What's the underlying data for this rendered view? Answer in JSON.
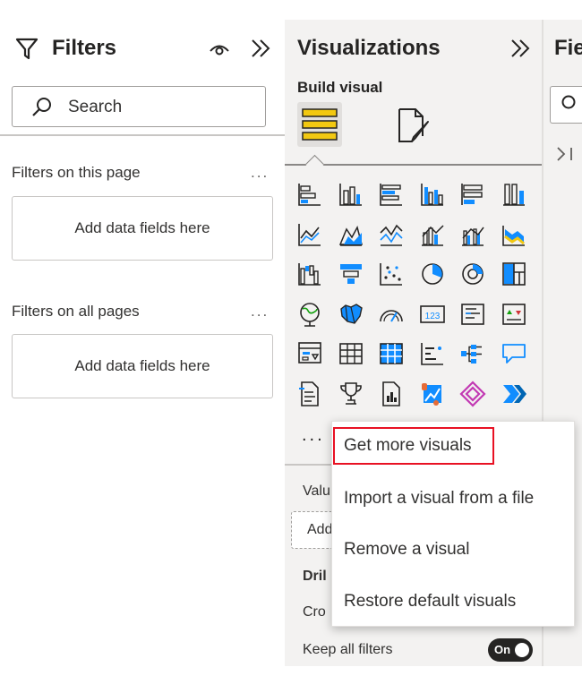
{
  "filters": {
    "title": "Filters",
    "search_placeholder": "Search",
    "this_page_title": "Filters on this page",
    "this_page_drop": "Add data fields here",
    "all_pages_title": "Filters on all pages",
    "all_pages_drop": "Add data fields here",
    "more": "..."
  },
  "visualizations": {
    "title": "Visualizations",
    "build_label": "Build visual",
    "more_visuals": "...",
    "values_label": "Valu",
    "add_label": "Add",
    "drill_label": "Dril",
    "cross_label": "Cro",
    "keep_filters_label": "Keep all filters",
    "toggle_label": "On",
    "icons": [
      [
        "stacked-bar-chart-icon",
        "stacked-column-chart-icon",
        "clustered-bar-chart-icon",
        "clustered-column-chart-icon",
        "100-stacked-bar-chart-icon",
        "100-stacked-column-chart-icon"
      ],
      [
        "line-chart-icon",
        "area-chart-icon",
        "stacked-area-chart-icon",
        "line-stacked-column-chart-icon",
        "line-clustered-column-chart-icon",
        "ribbon-chart-icon"
      ],
      [
        "waterfall-chart-icon",
        "funnel-icon",
        "scatter-chart-icon",
        "pie-chart-icon",
        "donut-chart-icon",
        "treemap-icon"
      ],
      [
        "map-icon",
        "filled-map-icon",
        "gauge-icon",
        "card-icon",
        "multi-row-card-icon",
        "kpi-icon"
      ],
      [
        "slicer-icon",
        "table-icon",
        "matrix-icon",
        "key-influencers-icon",
        "decomposition-tree-icon",
        "qa-icon"
      ],
      [
        "smart-narrative-icon",
        "metrics-icon",
        "paginated-report-icon",
        "azure-map-icon",
        "power-apps-icon",
        "power-automate-icon"
      ]
    ]
  },
  "fields": {
    "title": "Fie"
  },
  "context_menu": {
    "items": [
      "Get more visuals",
      "Import a visual from a file",
      "Remove a visual",
      "Restore default visuals"
    ]
  },
  "colors": {
    "accent_yellow": "#f2c811",
    "brand_blue": "#118dff",
    "highlight_red": "#e81123"
  }
}
